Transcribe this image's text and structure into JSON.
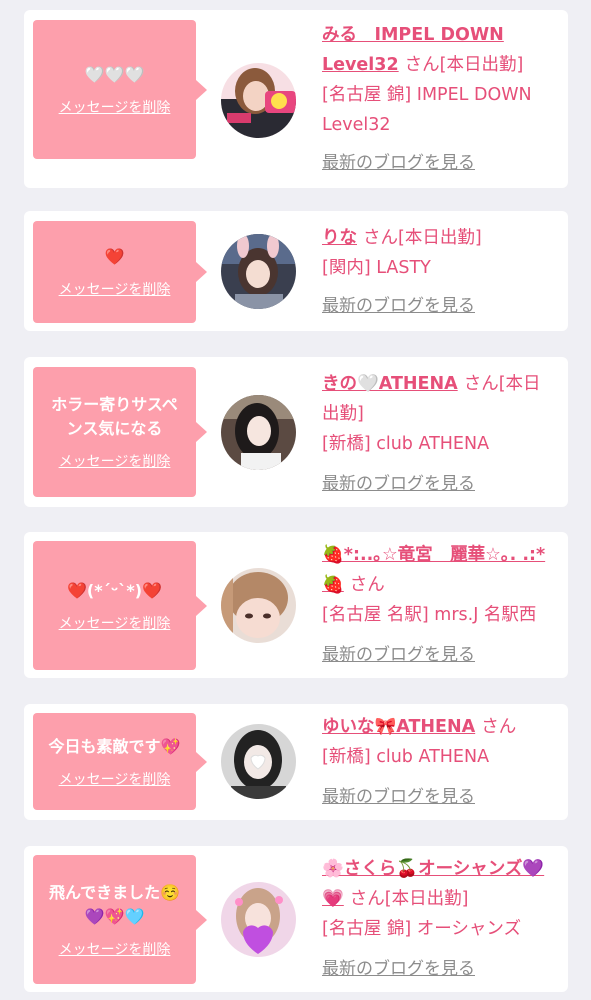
{
  "colors": {
    "page_bg": "#efeff4",
    "card_bg": "#ffffff",
    "bubble_bg": "#fd9fac",
    "accent_pink": "#e64f79",
    "muted_gray": "#8c8c8c"
  },
  "common": {
    "delete_label": "メッセージを削除",
    "blog_label": "最新のブログを見る",
    "honorific": "さん"
  },
  "messages": [
    {
      "message": "🤍🤍🤍",
      "name": "みる　IMPEL DOWN Level32",
      "status": "[本日出勤]",
      "store": "[名古屋 錦] IMPEL DOWN Level32"
    },
    {
      "message": "❤️",
      "name": "りな",
      "status": "[本日出勤]",
      "store": "[関内] LASTY"
    },
    {
      "message": "ホラー寄りサスペンス気になる",
      "name": "きの🤍ATHENA",
      "status": "[本日出勤]",
      "store": "[新橋] club ATHENA"
    },
    {
      "message": "❤️(*´ᵕ`*)❤️",
      "name": "🍓*:..｡☆竜宮　麗華☆｡. .:*🍓",
      "status": "",
      "store": "[名古屋 名駅] mrs.J 名駅西"
    },
    {
      "message": "今日も素敵です💖",
      "name": "ゆいな🎀ATHENA",
      "status": "",
      "store": "[新橋] club ATHENA"
    },
    {
      "message": "飛んできました☺️💜💖🩵",
      "name": "🌸さくら🍒オーシャンズ💜💗",
      "status": "[本日出勤]",
      "store": "[名古屋 錦] オーシャンズ"
    }
  ]
}
